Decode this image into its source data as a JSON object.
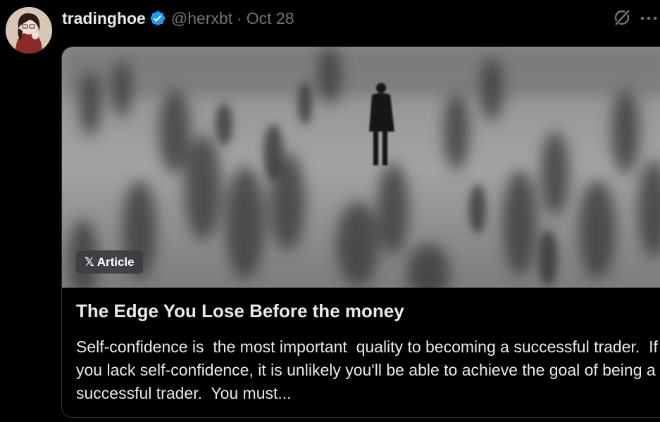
{
  "tweet": {
    "display_name": "tradinghoe",
    "handle": "@herxbt",
    "separator": "·",
    "date": "Oct 28",
    "verified": true
  },
  "icons": {
    "verified": "verified-badge-icon",
    "grok": "grok-icon",
    "more": "more-horizontal-icon",
    "x_logo": "x-logo-icon"
  },
  "article": {
    "badge_logo": "𝕏",
    "badge_label": "Article",
    "title": "The Edge You Lose Before the money",
    "description": "Self-confidence is  the most important  quality to becoming a successful trader.  If you lack self-confidence, it is unlikely you'll be able to achieve the goal of being a successful trader.  You must..."
  },
  "colors": {
    "background": "#000000",
    "text_primary": "#e7e9ea",
    "text_secondary": "#71767b",
    "verified_blue": "#1d9bf0",
    "card_border": "#2f3336"
  }
}
